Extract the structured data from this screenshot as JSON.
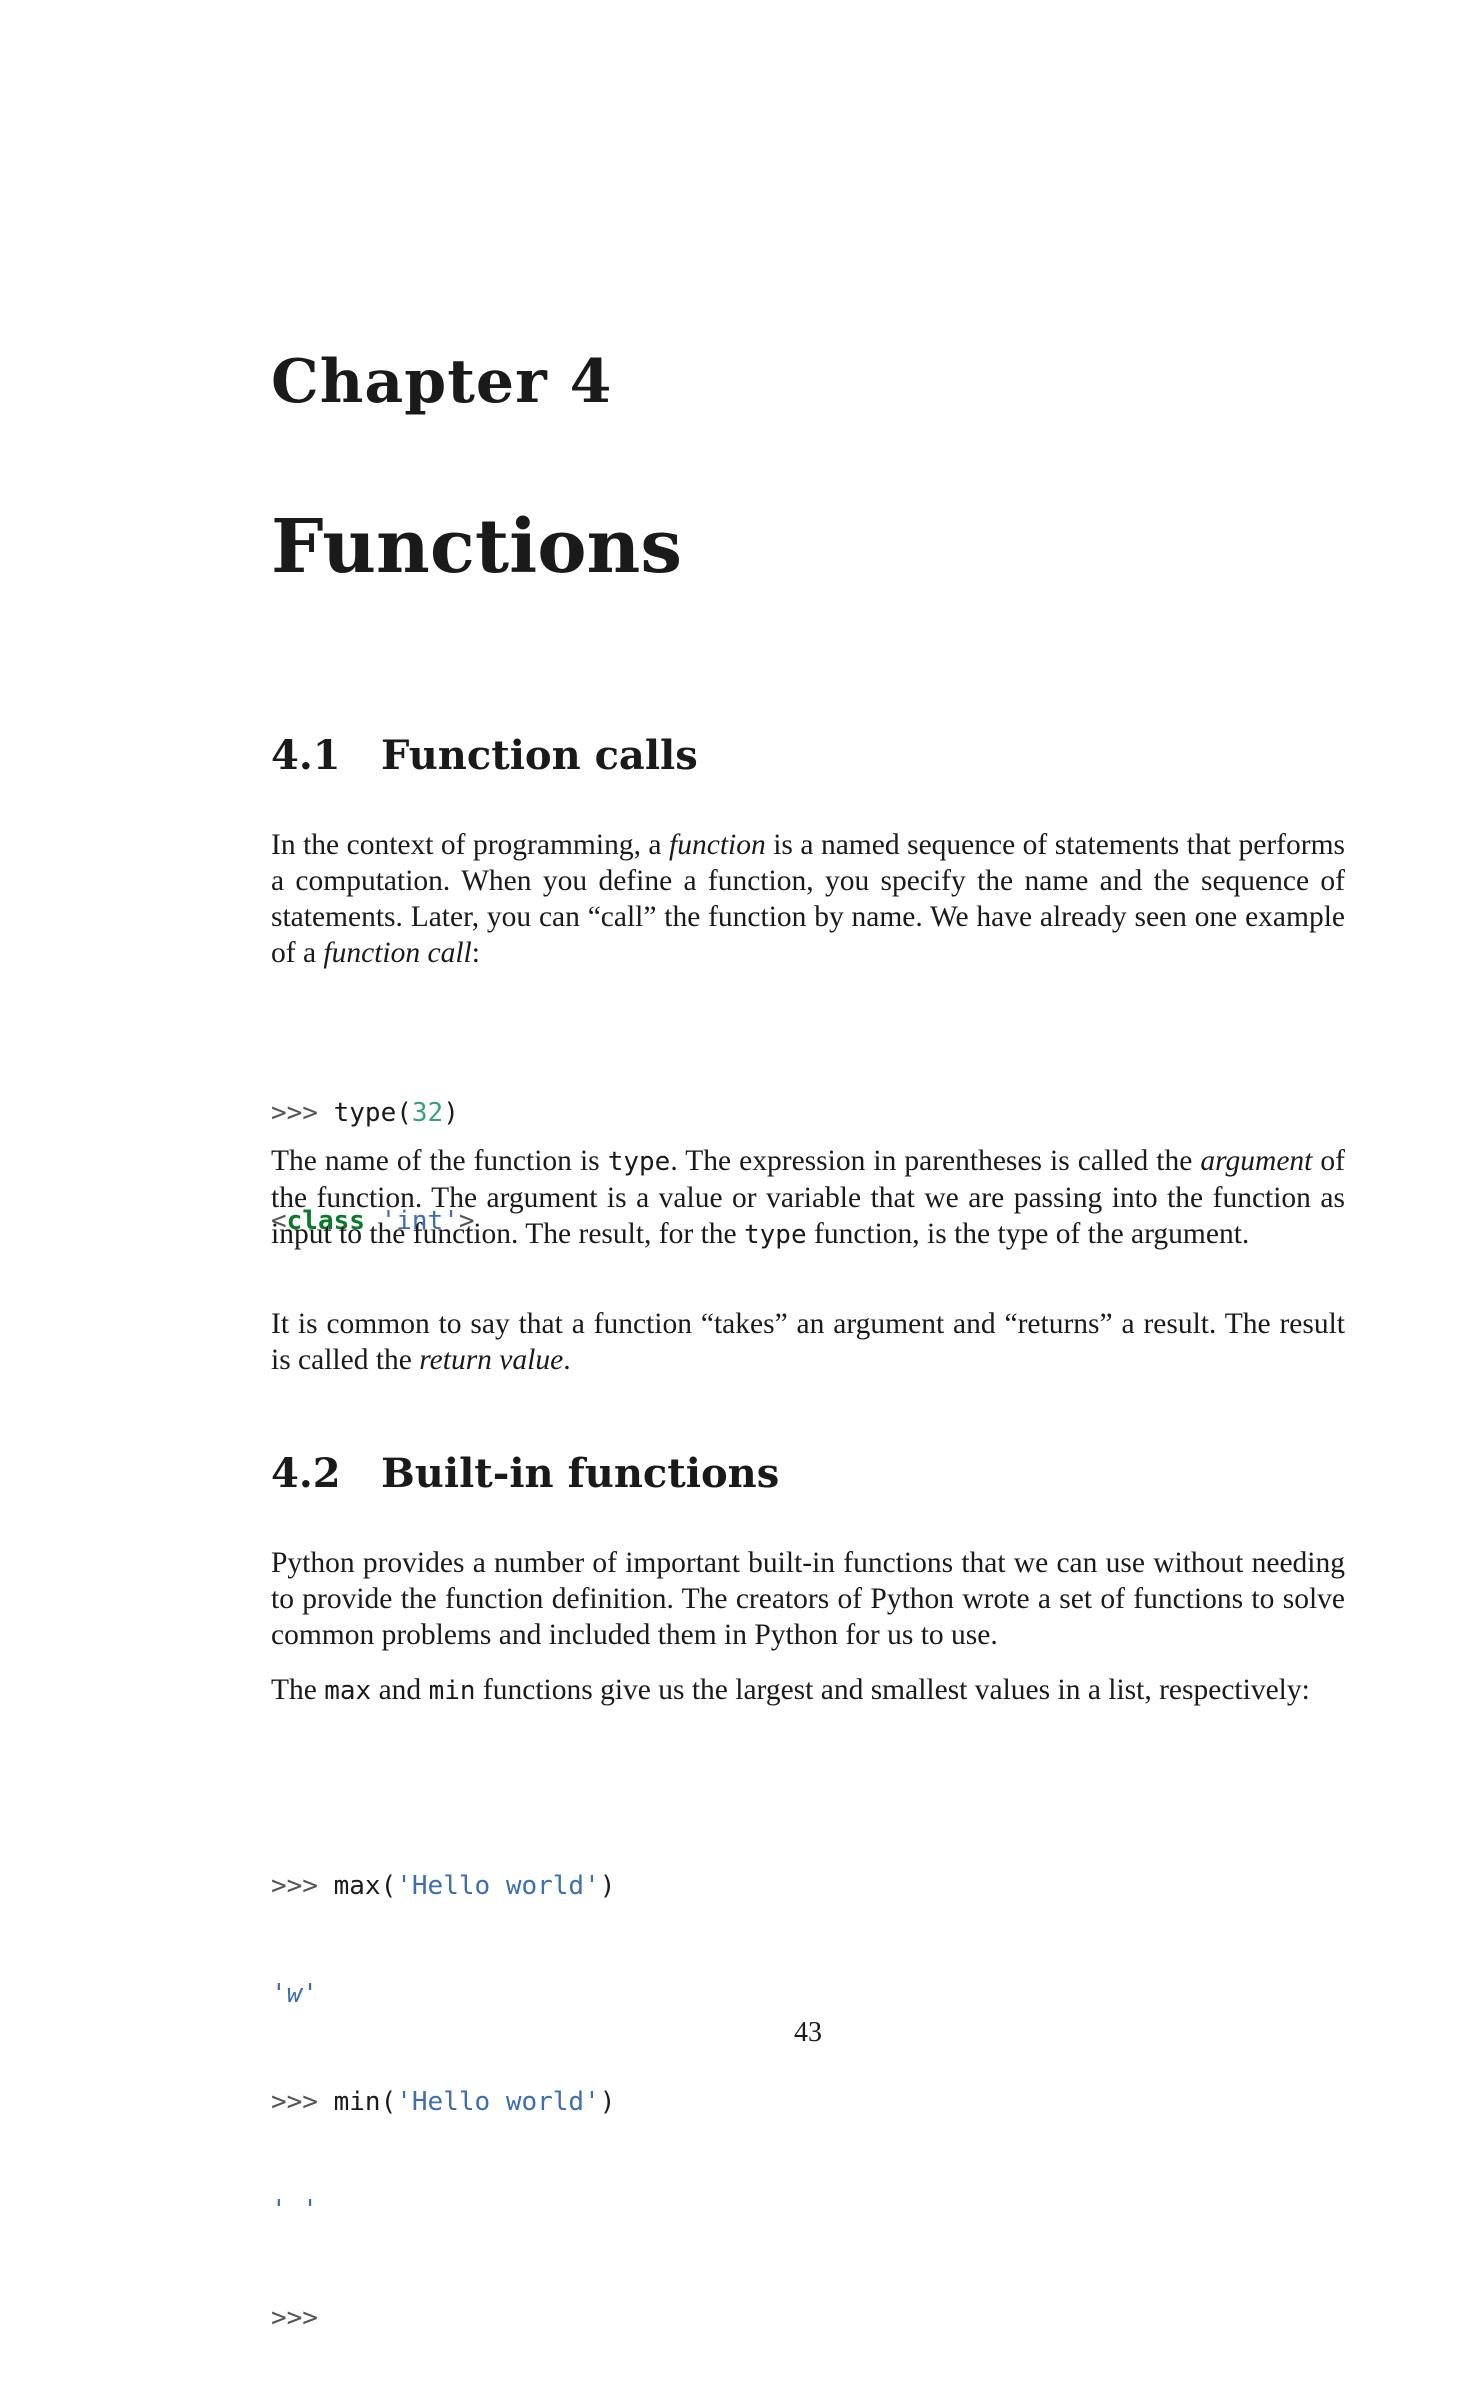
{
  "chapter": {
    "label": "Chapter 4",
    "title": "Functions"
  },
  "section1": {
    "number": "4.1",
    "title": "Function calls",
    "para1": {
      "t1": "In the context of programming, a ",
      "em1": "function",
      "t2": " is a named sequence of statements that performs a computation. When you define a function, you specify the name and the sequence of statements. Later, you can “call” the function by name. We have already seen one example of a ",
      "em2": "function call",
      "t3": ":"
    },
    "code": {
      "prompt": ">>>",
      "call_fn": "type(",
      "call_arg": "32",
      "call_close": ")",
      "out_open": "<",
      "out_kw": "class",
      "out_str": "'int'",
      "out_close": ">"
    },
    "para2": {
      "t1": "The name of the function is ",
      "code1": "type",
      "t2": ". The expression in parentheses is called the ",
      "em1": "argument",
      "t3": " of the function. The argument is a value or variable that we are passing into the function as input to the function. The result, for the ",
      "code2": "type",
      "t4": " function, is the type of the argument."
    },
    "para3": {
      "t1": "It is common to say that a function “takes” an argument and “returns” a result. The result is called the ",
      "em1": "return value",
      "t2": "."
    }
  },
  "section2": {
    "number": "4.2",
    "title": "Built-in functions",
    "para1": "Python provides a number of important built-in functions that we can use without needing to provide the function definition. The creators of Python wrote a set of functions to solve common problems and included them in Python for us to use.",
    "para2": {
      "t1": "The ",
      "code1": "max",
      "t2": " and ",
      "code2": "min",
      "t3": " functions give us the largest and smallest values in a list, respectively:"
    },
    "code": {
      "prompt": ">>>",
      "max_fn": "max(",
      "max_arg": "'Hello world'",
      "max_close": ")",
      "max_out": "'w'",
      "min_fn": "min(",
      "min_arg": "'Hello world'",
      "min_close": ")",
      "min_out": "' '",
      "last_prompt": ">>>"
    }
  },
  "page_number": "43"
}
